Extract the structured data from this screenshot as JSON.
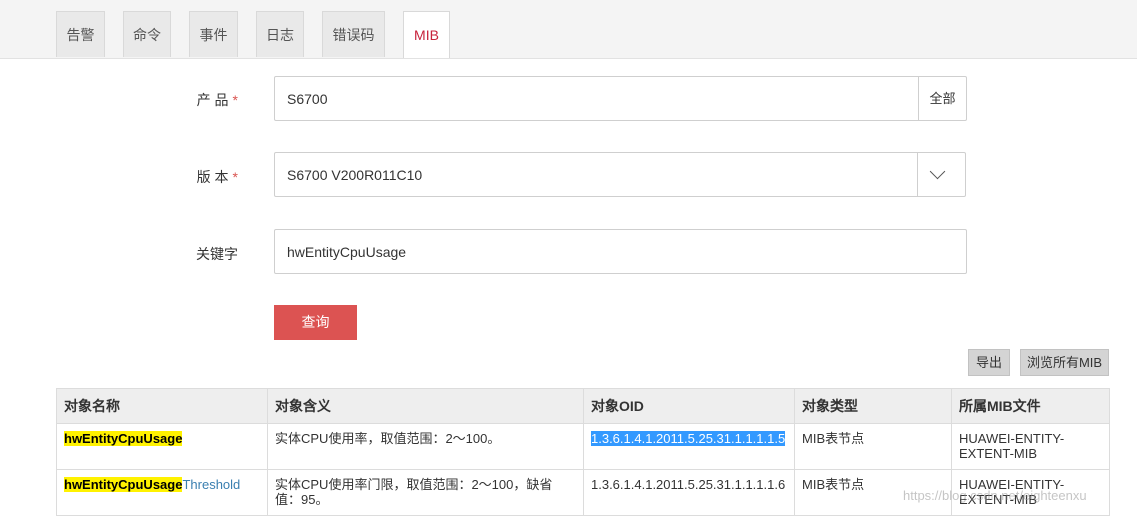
{
  "tabs": [
    {
      "label": "告警",
      "active": false
    },
    {
      "label": "命令",
      "active": false
    },
    {
      "label": "事件",
      "active": false
    },
    {
      "label": "日志",
      "active": false
    },
    {
      "label": "错误码",
      "active": false
    },
    {
      "label": "MIB",
      "active": true
    }
  ],
  "form": {
    "product": {
      "label": "产 品",
      "required_mark": "*",
      "value": "S6700",
      "addon_label": "全部"
    },
    "version": {
      "label": "版 本",
      "required_mark": "*",
      "value": "S6700 V200R011C10",
      "dropdown_icon": "chevron-down-icon"
    },
    "keyword": {
      "label": "关键字",
      "value": "hwEntityCpuUsage"
    },
    "query_button": "查询"
  },
  "actions": {
    "export_label": "导出",
    "browse_all_label": "浏览所有MIB"
  },
  "table": {
    "headers": [
      "对象名称",
      "对象含义",
      "对象OID",
      "对象类型",
      "所属MIB文件"
    ],
    "rows": [
      {
        "name_highlight": "hwEntityCpuUsage",
        "name_suffix": "",
        "meaning": "实体CPU使用率，取值范围：2～100。",
        "oid": "1.3.6.1.4.1.2011.5.25.31.1.1.1.1.5",
        "type": "MIB表节点",
        "mib_file": "HUAWEI-ENTITY-EXTENT-MIB"
      },
      {
        "name_highlight": "hwEntityCpuUsage",
        "name_suffix": "Threshold",
        "meaning": "实体CPU使用率门限，取值范围：2～100，缺省值：95。",
        "oid": "1.3.6.1.4.1.2011.5.25.31.1.1.1.1.6",
        "type": "MIB表节点",
        "mib_file": "HUAWEI-ENTITY-EXTENT-MIB"
      }
    ]
  },
  "watermark": "https://blog.csdn.net/eighteenxu",
  "colors": {
    "active_tab_text": "#c7223b",
    "query_button_bg": "#dc5352",
    "required_mark": "#d9534f",
    "keyword_highlight": "#fff200",
    "selection": "#3399ff",
    "link": "#3a7fb0"
  }
}
